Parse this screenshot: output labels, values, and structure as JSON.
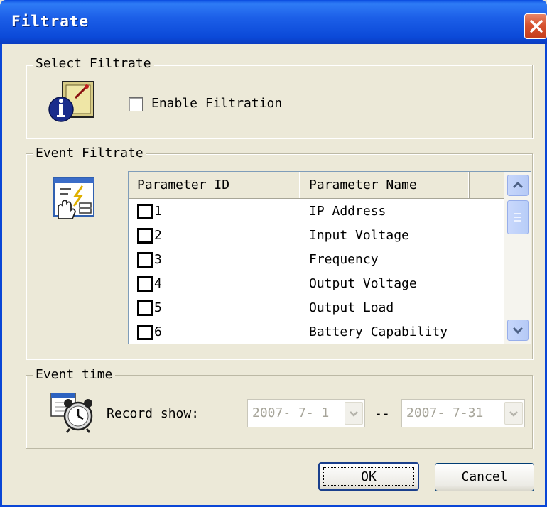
{
  "window": {
    "title": "Filtrate"
  },
  "select_filtrate": {
    "legend": "Select Filtrate",
    "enable_label": "Enable Filtration",
    "enable_checked": false
  },
  "event_filtrate": {
    "legend": "Event Filtrate",
    "columns": [
      "Parameter ID",
      "Parameter Name"
    ],
    "rows": [
      {
        "id": "1",
        "name": "IP Address"
      },
      {
        "id": "2",
        "name": "Input Voltage"
      },
      {
        "id": "3",
        "name": "Frequency"
      },
      {
        "id": "4",
        "name": "Output Voltage"
      },
      {
        "id": "5",
        "name": "Output Load"
      },
      {
        "id": "6",
        "name": "Battery Capability"
      }
    ]
  },
  "event_time": {
    "legend": "Event time",
    "record_label": "Record show:",
    "from_date": "2007- 7- 1",
    "separator": "--",
    "to_date": "2007- 7-31"
  },
  "buttons": {
    "ok": "OK",
    "cancel": "Cancel"
  }
}
